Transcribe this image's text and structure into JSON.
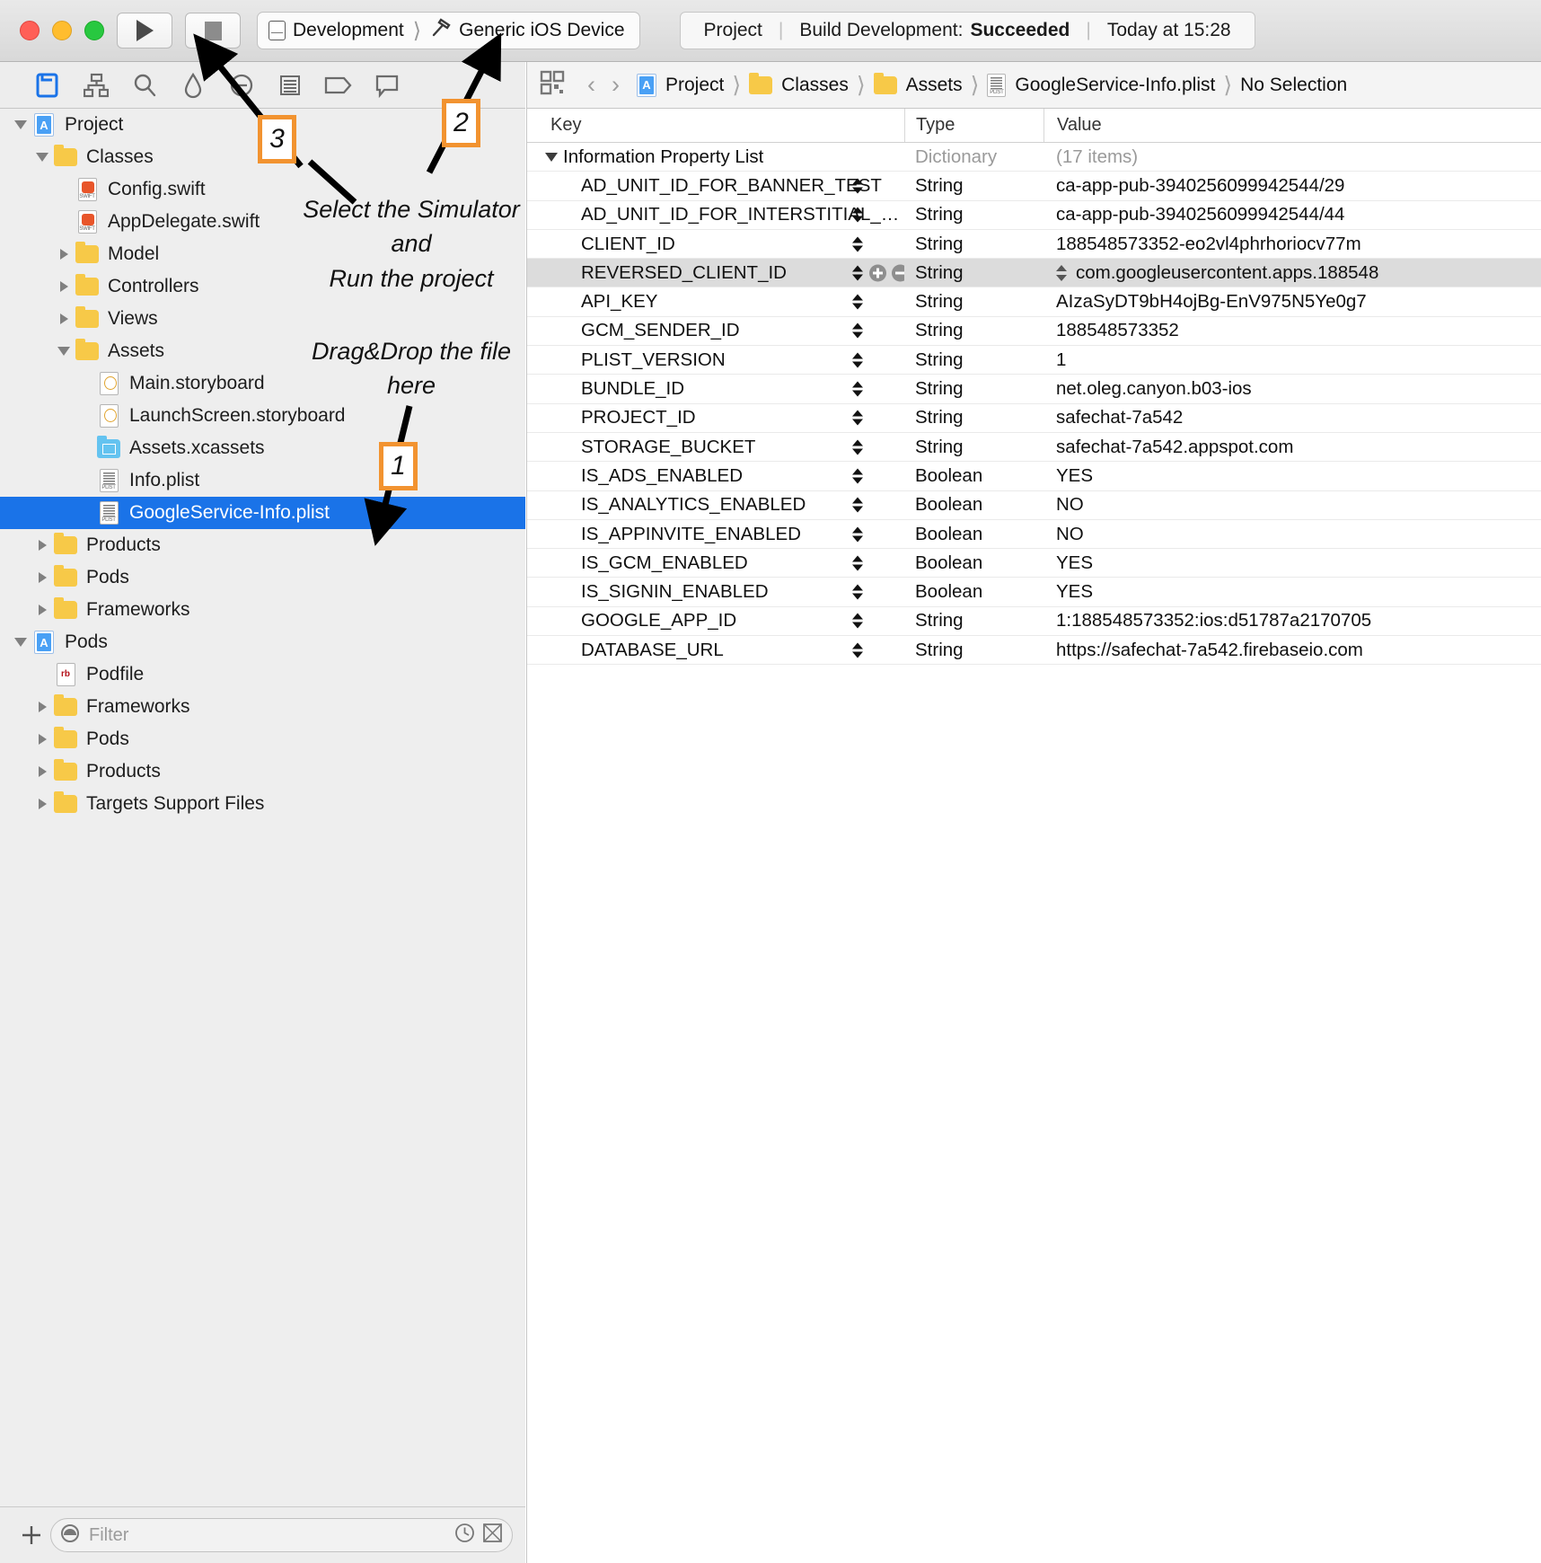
{
  "window": {
    "traffic_lights": [
      "close",
      "minimize",
      "zoom"
    ],
    "run_button": "run",
    "stop_button": "stop"
  },
  "scheme": {
    "name": "Development",
    "destination": "Generic iOS Device"
  },
  "status": {
    "project": "Project",
    "build": "Build Development:",
    "result": "Succeeded",
    "time": "Today at 15:28"
  },
  "navigator_icons": [
    "folder-icon",
    "hierarchy-icon",
    "search-icon",
    "warning-icon",
    "debug-icon",
    "breakpoint-icon",
    "tag-icon",
    "comment-icon"
  ],
  "jumpbar": {
    "grid_icon": "grid-icon",
    "back": "‹",
    "forward": "›",
    "crumbs": [
      "Project",
      "Classes",
      "Assets",
      "GoogleService-Info.plist",
      "No Selection"
    ]
  },
  "sidebar": {
    "items": [
      {
        "label": "Project",
        "indent": 0,
        "icon": "app-icon",
        "twisty": "open"
      },
      {
        "label": "Classes",
        "indent": 1,
        "icon": "folder-icon",
        "twisty": "open"
      },
      {
        "label": "Config.swift",
        "indent": 2,
        "icon": "swift-icon",
        "twisty": "none"
      },
      {
        "label": "AppDelegate.swift",
        "indent": 2,
        "icon": "swift-icon",
        "twisty": "none"
      },
      {
        "label": "Model",
        "indent": 2,
        "icon": "folder-icon",
        "twisty": "closed"
      },
      {
        "label": "Controllers",
        "indent": 2,
        "icon": "folder-icon",
        "twisty": "closed"
      },
      {
        "label": "Views",
        "indent": 2,
        "icon": "folder-icon",
        "twisty": "closed"
      },
      {
        "label": "Assets",
        "indent": 2,
        "icon": "folder-icon",
        "twisty": "open"
      },
      {
        "label": "Main.storyboard",
        "indent": 3,
        "icon": "storyboard-icon",
        "twisty": "none"
      },
      {
        "label": "LaunchScreen.storyboard",
        "indent": 3,
        "icon": "storyboard-icon",
        "twisty": "none"
      },
      {
        "label": "Assets.xcassets",
        "indent": 3,
        "icon": "xcassets-icon",
        "twisty": "none"
      },
      {
        "label": "Info.plist",
        "indent": 3,
        "icon": "plist-icon",
        "twisty": "none"
      },
      {
        "label": "GoogleService-Info.plist",
        "indent": 3,
        "icon": "plist-icon",
        "twisty": "none",
        "selected": true
      },
      {
        "label": "Products",
        "indent": 1,
        "icon": "folder-icon",
        "twisty": "closed"
      },
      {
        "label": "Pods",
        "indent": 1,
        "icon": "folder-icon",
        "twisty": "closed"
      },
      {
        "label": "Frameworks",
        "indent": 1,
        "icon": "folder-icon",
        "twisty": "closed"
      },
      {
        "label": "Pods",
        "indent": 0,
        "icon": "app-icon",
        "twisty": "open"
      },
      {
        "label": "Podfile",
        "indent": 1,
        "icon": "ruby-icon",
        "twisty": "none"
      },
      {
        "label": "Frameworks",
        "indent": 1,
        "icon": "folder-icon",
        "twisty": "closed"
      },
      {
        "label": "Pods",
        "indent": 1,
        "icon": "folder-icon",
        "twisty": "closed"
      },
      {
        "label": "Products",
        "indent": 1,
        "icon": "folder-icon",
        "twisty": "closed"
      },
      {
        "label": "Targets Support Files",
        "indent": 1,
        "icon": "folder-icon",
        "twisty": "closed"
      }
    ]
  },
  "filter": {
    "add_label": "+",
    "placeholder": "Filter",
    "recent_icon": "clock-icon",
    "scope_icon": "scope-icon"
  },
  "plist": {
    "columns": [
      "Key",
      "Type",
      "Value"
    ],
    "rows": [
      {
        "key": "Information Property List",
        "type": "Dictionary",
        "value": "(17 items)",
        "root": true
      },
      {
        "key": "AD_UNIT_ID_FOR_BANNER_TEST",
        "type": "String",
        "value": "ca-app-pub-3940256099942544/29"
      },
      {
        "key": "AD_UNIT_ID_FOR_INTERSTITIAL_T…",
        "type": "String",
        "value": "ca-app-pub-3940256099942544/44"
      },
      {
        "key": "CLIENT_ID",
        "type": "String",
        "value": "188548573352-eo2vl4phrhoriocv77m"
      },
      {
        "key": "REVERSED_CLIENT_ID",
        "type": "String",
        "value": "com.googleusercontent.apps.188548",
        "selected": true
      },
      {
        "key": "API_KEY",
        "type": "String",
        "value": "AIzaSyDT9bH4ojBg-EnV975N5Ye0g7"
      },
      {
        "key": "GCM_SENDER_ID",
        "type": "String",
        "value": "188548573352"
      },
      {
        "key": "PLIST_VERSION",
        "type": "String",
        "value": "1"
      },
      {
        "key": "BUNDLE_ID",
        "type": "String",
        "value": "net.oleg.canyon.b03-ios"
      },
      {
        "key": "PROJECT_ID",
        "type": "String",
        "value": "safechat-7a542"
      },
      {
        "key": "STORAGE_BUCKET",
        "type": "String",
        "value": "safechat-7a542.appspot.com"
      },
      {
        "key": "IS_ADS_ENABLED",
        "type": "Boolean",
        "value": "YES"
      },
      {
        "key": "IS_ANALYTICS_ENABLED",
        "type": "Boolean",
        "value": "NO"
      },
      {
        "key": "IS_APPINVITE_ENABLED",
        "type": "Boolean",
        "value": "NO"
      },
      {
        "key": "IS_GCM_ENABLED",
        "type": "Boolean",
        "value": "YES"
      },
      {
        "key": "IS_SIGNIN_ENABLED",
        "type": "Boolean",
        "value": "YES"
      },
      {
        "key": "GOOGLE_APP_ID",
        "type": "String",
        "value": "1:188548573352:ios:d51787a2170705"
      },
      {
        "key": "DATABASE_URL",
        "type": "String",
        "value": "https://safechat-7a542.firebaseio.com"
      }
    ]
  },
  "annotations": {
    "accent_color": "#f29330",
    "badge_1": "1",
    "badge_2": "2",
    "badge_3": "3",
    "text_run": "Select the Simulator\nand\nRun the project",
    "text_drag": "Drag&Drop the file\nhere"
  }
}
